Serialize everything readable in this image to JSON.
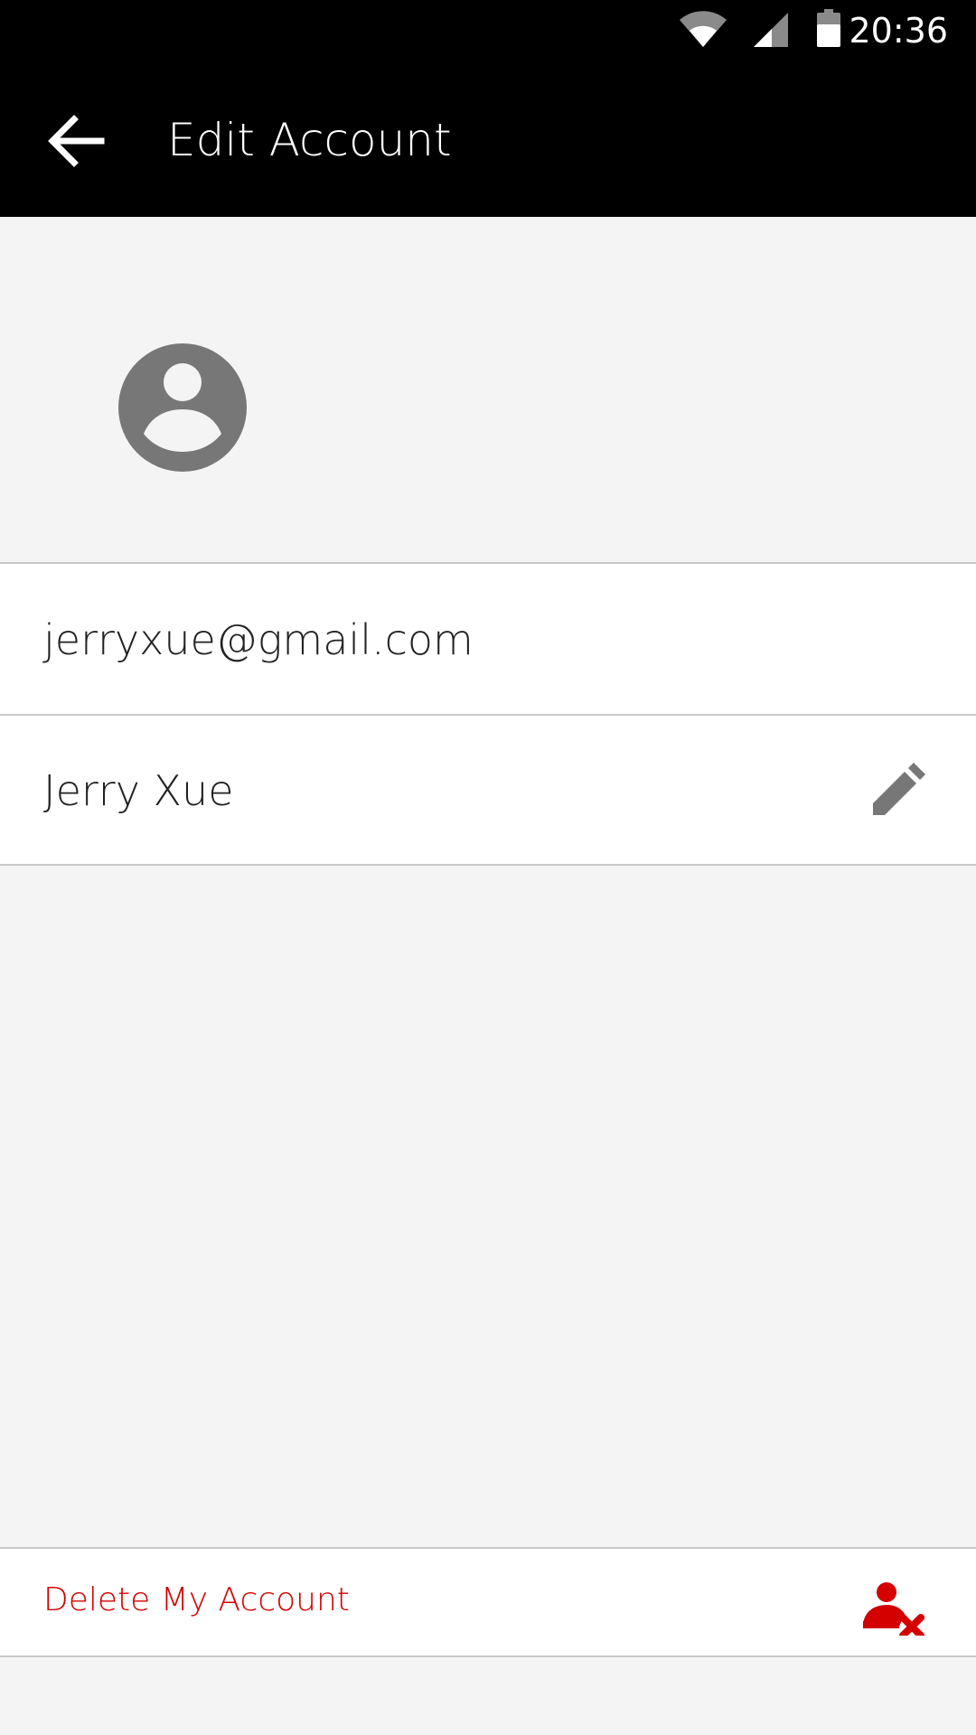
{
  "status_bar": {
    "time": "20:36",
    "icons": [
      "wifi-icon",
      "cellular-signal-icon",
      "battery-icon"
    ]
  },
  "app_bar": {
    "title": "Edit Account",
    "back_icon": "arrow-left-icon"
  },
  "profile": {
    "avatar_icon": "account-circle-icon",
    "email": "jerryxue@gmail.com",
    "name": "Jerry Xue",
    "edit_icon": "pencil-icon"
  },
  "delete": {
    "label": "Delete My Account",
    "icon": "user-remove-icon"
  },
  "colors": {
    "app_bar": "#000000",
    "background": "#f4f4f4",
    "danger": "#d40000",
    "icon_gray": "#777777"
  }
}
